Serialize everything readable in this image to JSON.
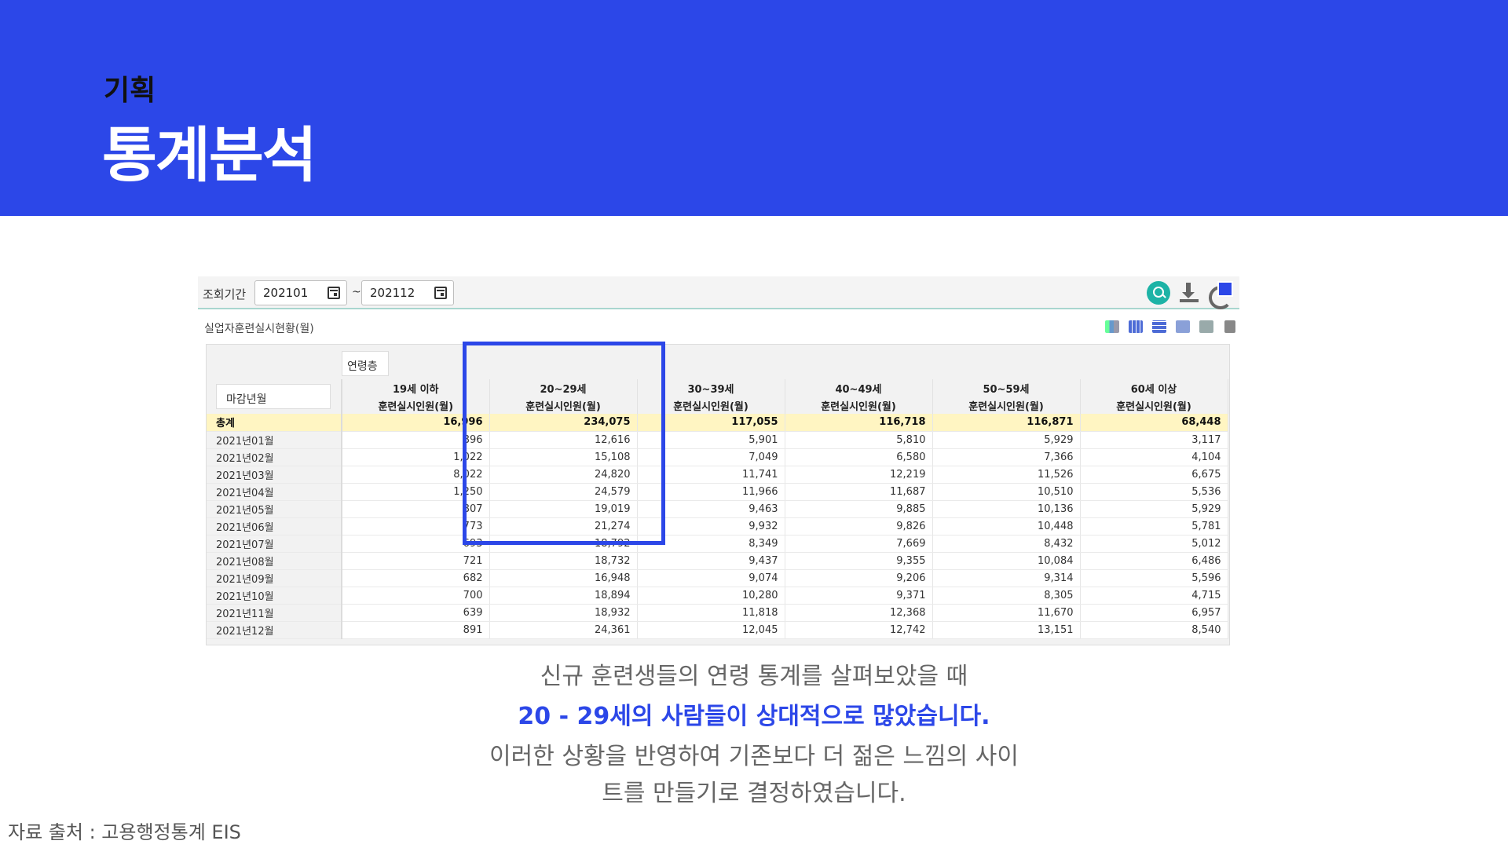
{
  "header": {
    "kicker": "기획",
    "title": "통계분석"
  },
  "toolbar": {
    "period_label": "조회기간",
    "start_value": "202101",
    "separator": "~",
    "end_value": "202112"
  },
  "report_title": "실업자훈련실시현황(월)",
  "pivot": {
    "column_dim": "연령층",
    "row_dim": "마감년월"
  },
  "table": {
    "groups": [
      "19세 이하",
      "20~29세",
      "30~39세",
      "40~49세",
      "50~59세",
      "60세 이상"
    ],
    "measure": "훈련실시인원(월)",
    "rows": [
      {
        "label": "총계",
        "values": [
          "16,996",
          "234,075",
          "117,055",
          "116,718",
          "116,871",
          "68,448"
        ]
      },
      {
        "label": "2021년01월",
        "values": [
          "896",
          "12,616",
          "5,901",
          "5,810",
          "5,929",
          "3,117"
        ]
      },
      {
        "label": "2021년02월",
        "values": [
          "1,022",
          "15,108",
          "7,049",
          "6,580",
          "7,366",
          "4,104"
        ]
      },
      {
        "label": "2021년03월",
        "values": [
          "8,022",
          "24,820",
          "11,741",
          "12,219",
          "11,526",
          "6,675"
        ]
      },
      {
        "label": "2021년04월",
        "values": [
          "1,250",
          "24,579",
          "11,966",
          "11,687",
          "10,510",
          "5,536"
        ]
      },
      {
        "label": "2021년05월",
        "values": [
          "807",
          "19,019",
          "9,463",
          "9,885",
          "10,136",
          "5,929"
        ]
      },
      {
        "label": "2021년06월",
        "values": [
          "773",
          "21,274",
          "9,932",
          "9,826",
          "10,448",
          "5,781"
        ]
      },
      {
        "label": "2021년07월",
        "values": [
          "693",
          "18,792",
          "8,349",
          "7,669",
          "8,432",
          "5,012"
        ]
      },
      {
        "label": "2021년08월",
        "values": [
          "721",
          "18,732",
          "9,437",
          "9,355",
          "10,084",
          "6,486"
        ]
      },
      {
        "label": "2021년09월",
        "values": [
          "682",
          "16,948",
          "9,074",
          "9,206",
          "9,314",
          "5,596"
        ]
      },
      {
        "label": "2021년10월",
        "values": [
          "700",
          "18,894",
          "10,280",
          "9,371",
          "8,305",
          "4,715"
        ]
      },
      {
        "label": "2021년11월",
        "values": [
          "639",
          "18,932",
          "11,818",
          "12,368",
          "11,670",
          "6,957"
        ]
      },
      {
        "label": "2021년12월",
        "values": [
          "891",
          "24,361",
          "12,045",
          "12,742",
          "13,151",
          "8,540"
        ]
      }
    ]
  },
  "caption": {
    "line1": "신규 훈련생들의 연령 통계를 살펴보았을 때",
    "line2": "20 - 29세의 사람들이 상대적으로 많았습니다.",
    "line3": "이러한 상황을 반영하여 기존보다 더 젊은 느낌의 사이",
    "line4": "트를 만들기로 결정하였습니다."
  },
  "source": "자료 출처 : 고용행정통계 EIS",
  "colors": {
    "brand_blue": "#2c47e8",
    "total_row": "#fff5c2",
    "search_green": "#1db3a6"
  }
}
